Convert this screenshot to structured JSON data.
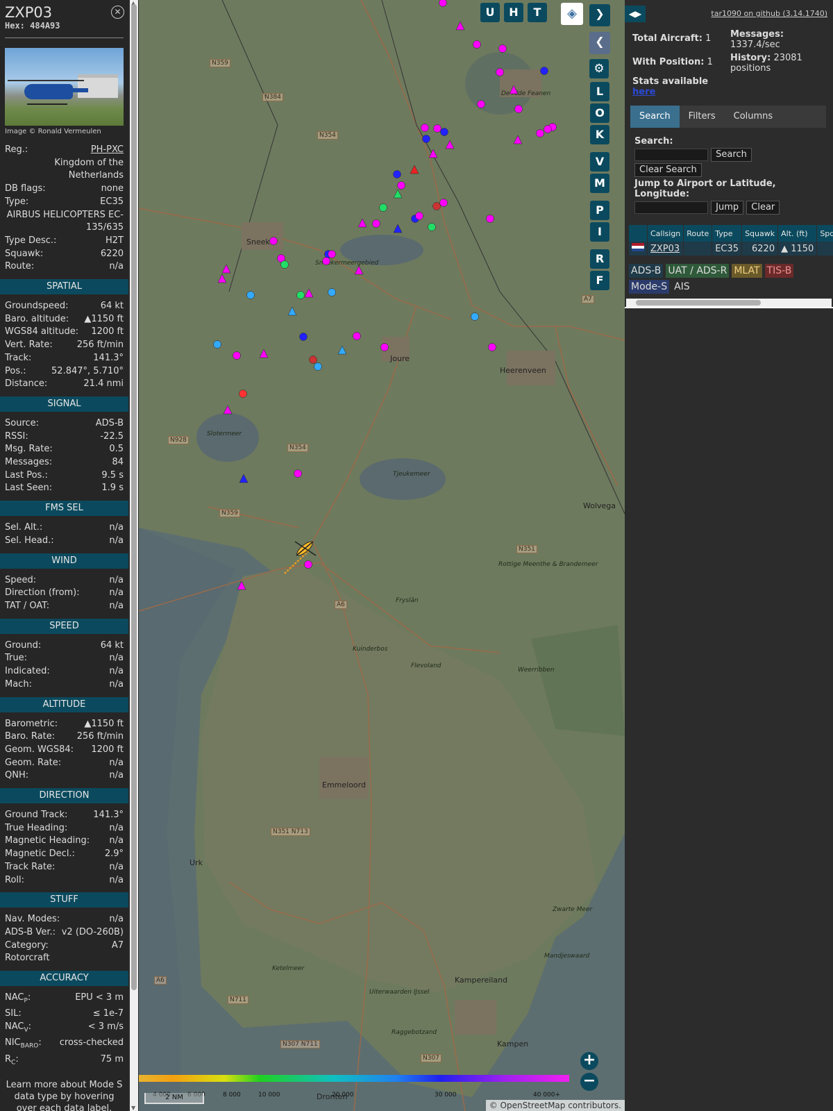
{
  "aircraft": {
    "callsign": "ZXP03",
    "hex_label": "Hex:",
    "hex": "484A93",
    "photo_credit": "Image © Ronald Vermeulen",
    "fields": [
      {
        "k": "Reg.:",
        "v": "PH-PXC"
      },
      {
        "k": "",
        "v": "Kingdom of the Netherlands"
      },
      {
        "k": "DB flags:",
        "v": "none"
      },
      {
        "k": "Type:",
        "v": "EC35"
      },
      {
        "k": "",
        "v": "AIRBUS HELICOPTERS EC-135/635"
      },
      {
        "k": "Type Desc.:",
        "v": "H2T"
      },
      {
        "k": "Squawk:",
        "v": "6220"
      },
      {
        "k": "Route:",
        "v": "n/a"
      }
    ]
  },
  "sections": [
    {
      "title": "SPATIAL",
      "rows": [
        {
          "k": "Groundspeed:",
          "v": "64 kt"
        },
        {
          "k": "Baro. altitude:",
          "v": "▲1150 ft"
        },
        {
          "k": "WGS84 altitude:",
          "v": "1200 ft"
        },
        {
          "k": "Vert. Rate:",
          "v": "256 ft/min"
        },
        {
          "k": "Track:",
          "v": "141.3°"
        },
        {
          "k": "Pos.:",
          "v": "52.847°, 5.710°"
        },
        {
          "k": "Distance:",
          "v": "21.4 nmi"
        }
      ]
    },
    {
      "title": "SIGNAL",
      "rows": [
        {
          "k": "Source:",
          "v": "ADS-B"
        },
        {
          "k": "RSSI:",
          "v": "-22.5"
        },
        {
          "k": "Msg. Rate:",
          "v": "0.5"
        },
        {
          "k": "Messages:",
          "v": "84"
        },
        {
          "k": "",
          "v": ""
        },
        {
          "k": "Last Pos.:",
          "v": "9.5 s"
        },
        {
          "k": "Last Seen:",
          "v": "1.9 s"
        }
      ]
    },
    {
      "title": "FMS SEL",
      "rows": [
        {
          "k": "Sel. Alt.:",
          "v": "n/a"
        },
        {
          "k": "Sel. Head.:",
          "v": "n/a"
        }
      ]
    },
    {
      "title": "WIND",
      "rows": [
        {
          "k": "Speed:",
          "v": "n/a"
        },
        {
          "k": "Direction (from):",
          "v": "n/a"
        },
        {
          "k": "TAT / OAT:",
          "v": "n/a"
        }
      ]
    },
    {
      "title": "SPEED",
      "rows": [
        {
          "k": "Ground:",
          "v": "64 kt"
        },
        {
          "k": "True:",
          "v": "n/a"
        },
        {
          "k": "Indicated:",
          "v": "n/a"
        },
        {
          "k": "Mach:",
          "v": "n/a"
        }
      ]
    },
    {
      "title": "ALTITUDE",
      "rows": [
        {
          "k": "Barometric:",
          "v": "▲1150 ft"
        },
        {
          "k": "Baro. Rate:",
          "v": "256 ft/min"
        },
        {
          "k": "Geom. WGS84:",
          "v": "1200 ft"
        },
        {
          "k": "Geom. Rate:",
          "v": "n/a"
        },
        {
          "k": "QNH:",
          "v": "n/a"
        }
      ]
    },
    {
      "title": "DIRECTION",
      "rows": [
        {
          "k": "Ground Track:",
          "v": "141.3°"
        },
        {
          "k": "True Heading:",
          "v": "n/a"
        },
        {
          "k": "Magnetic Heading:",
          "v": "n/a"
        },
        {
          "k": "Magnetic Decl.:",
          "v": "2.9°"
        },
        {
          "k": "Track Rate:",
          "v": "n/a"
        },
        {
          "k": "Roll:",
          "v": "n/a"
        }
      ]
    },
    {
      "title": "STUFF",
      "rows": [
        {
          "k": "Nav. Modes:",
          "v": "n/a"
        },
        {
          "k": "ADS-B Ver.:",
          "v": "v2 (DO-260B)"
        },
        {
          "k": "Category:",
          "v": "A7"
        },
        {
          "k": "Rotorcraft",
          "v": ""
        }
      ]
    },
    {
      "title": "ACCURACY",
      "rows": [
        {
          "k": "NAC",
          "sub": "P",
          "v": "EPU < 3 m"
        },
        {
          "k": "SIL:",
          "v": "≤ 1e-7"
        },
        {
          "k": "NAC",
          "sub": "V",
          "v": "< 3 m/s"
        },
        {
          "k": "NIC",
          "sub": "BARO",
          "v": "cross-checked"
        },
        {
          "k": "R",
          "sub": "C",
          "v": "75 m"
        }
      ]
    }
  ],
  "learn_more": "Learn more about Mode S data type by hovering over each data label.",
  "map": {
    "buttons_top": [
      "U",
      "H",
      "T"
    ],
    "buttons_side": [
      "L",
      "O",
      "K",
      "V",
      "M",
      "P",
      "I",
      "R",
      "F"
    ],
    "places": [
      "Sneek",
      "Joure",
      "Heerenveen",
      "Wolvega",
      "Emmeloord",
      "Urk",
      "Dronten",
      "Kampen",
      "Kampereiland",
      "De Alde Feanen",
      "Weerribben",
      "Kuinderbos",
      "Flevoland",
      "Ketelmeer",
      "Zwarte Meer",
      "Mandjeswaard",
      "Tjeukemeer",
      "Sneekermeergebied",
      "Slotermeer",
      "Uiterwaarden IJssel",
      "Rottige Meenthe & Brandemeer",
      "Raggebotzand",
      "Fryslân"
    ],
    "roads": [
      "N359",
      "N384",
      "N354",
      "N928",
      "N354",
      "N359",
      "N351",
      "A6",
      "N351 N713",
      "A6",
      "N711",
      "N307 N711",
      "N307",
      "A7"
    ],
    "altitude_scale": [
      "4 000",
      "6 000",
      "8 000",
      "10 000",
      "20 000",
      "30 000",
      "40 000+"
    ],
    "scale_label": "2 NM",
    "zoom_in": "+",
    "zoom_out": "−",
    "attribution": "© OpenStreetMap contributors."
  },
  "panel": {
    "github_link": "tar1090 on github (3.14.1740)",
    "total_aircraft_label": "Total Aircraft:",
    "total_aircraft": "1",
    "messages_label": "Messages:",
    "messages": "1337.4/sec",
    "with_position_label": "With Position:",
    "with_position": "1",
    "history_label": "History:",
    "history": "23081 positions",
    "stats_text": "Stats available",
    "stats_link": "here",
    "tabs": [
      "Search",
      "Filters",
      "Columns"
    ],
    "search_label": "Search:",
    "search_button": "Search",
    "clear_search_button": "Clear Search",
    "jump_label": "Jump to Airport or Latitude, Longitude:",
    "jump_button": "Jump",
    "clear_button": "Clear",
    "table": {
      "headers": [
        "",
        "Callsign",
        "Route",
        "Type",
        "Squawk",
        "Alt. (ft)",
        "Spd"
      ],
      "row": {
        "callsign": "ZXP03",
        "route": "",
        "type": "EC35",
        "squawk": "6220",
        "alt": "▲ 1150"
      }
    },
    "sources": [
      {
        "label": "ADS-B",
        "color": "#1f3a48"
      },
      {
        "label": "UAT / ADS-R",
        "color": "#2f5a3a"
      },
      {
        "label": "MLAT",
        "color": "#6a5a2a"
      },
      {
        "label": "TIS-B",
        "color": "#6a2a2a"
      },
      {
        "label": "Mode-S",
        "color": "#2a3a6a"
      },
      {
        "label": "AIS",
        "color": "#2c2c2c"
      }
    ]
  }
}
